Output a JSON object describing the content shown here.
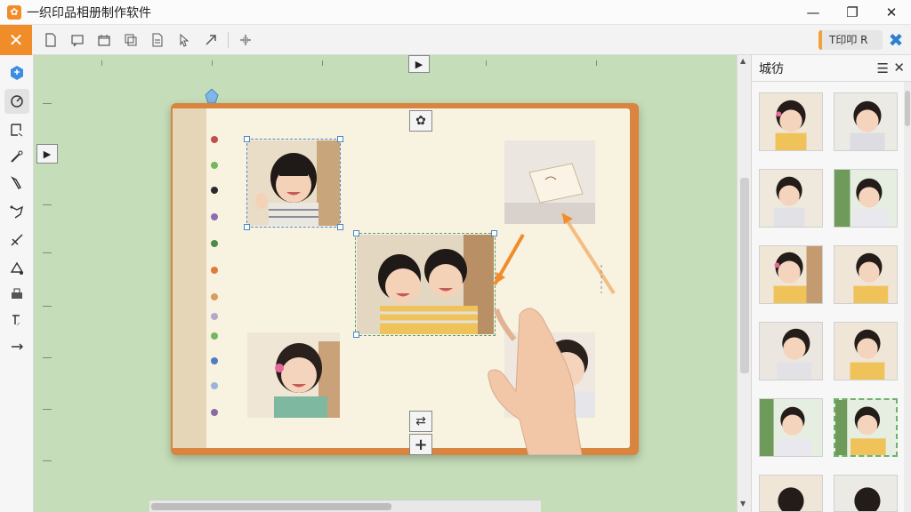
{
  "app": {
    "title": "一织印品相册制作软件",
    "icon_name": "app-logo-icon"
  },
  "window_controls": {
    "minimize": "—",
    "maximize": "❐",
    "close": "✕"
  },
  "toolbar": {
    "close_label": "✕",
    "mode_label": "T印叩 R",
    "clear_label": "✖",
    "icons": [
      "new-page-icon",
      "text-box-icon",
      "folder-icon",
      "duplicate-icon",
      "page-icon",
      "pointer-icon",
      "arrow-tool-icon",
      "grid-icon"
    ]
  },
  "left_tools": [
    "layer-icon",
    "rotate-icon",
    "crop-icon",
    "wand-icon",
    "pen-icon",
    "lasso-icon",
    "cross-line-icon",
    "fill-icon",
    "stamp-icon",
    "corner-icon",
    "line-icon"
  ],
  "canvas": {
    "background": "#c5ddb9",
    "play_label": "▶",
    "left_play_label": "▶",
    "settings_label": "✿",
    "swap_label": "⇄",
    "add_label": "+",
    "dot_colors": [
      "#c0504d",
      "#7ab55c",
      "#2b2b2b",
      "#8f6bb3",
      "#4e8a4a",
      "#e07b39",
      "#d6a05a",
      "#b9a7c9",
      "#7ab55c",
      "#4a7fc1",
      "#9ab3d8",
      "#8b6a9e"
    ]
  },
  "right_panel": {
    "title": "城彷",
    "menu_label": "☰",
    "close_label": "✕",
    "thumbnail_count": 12
  },
  "scroll": {
    "up": "▲",
    "down": "▼"
  }
}
